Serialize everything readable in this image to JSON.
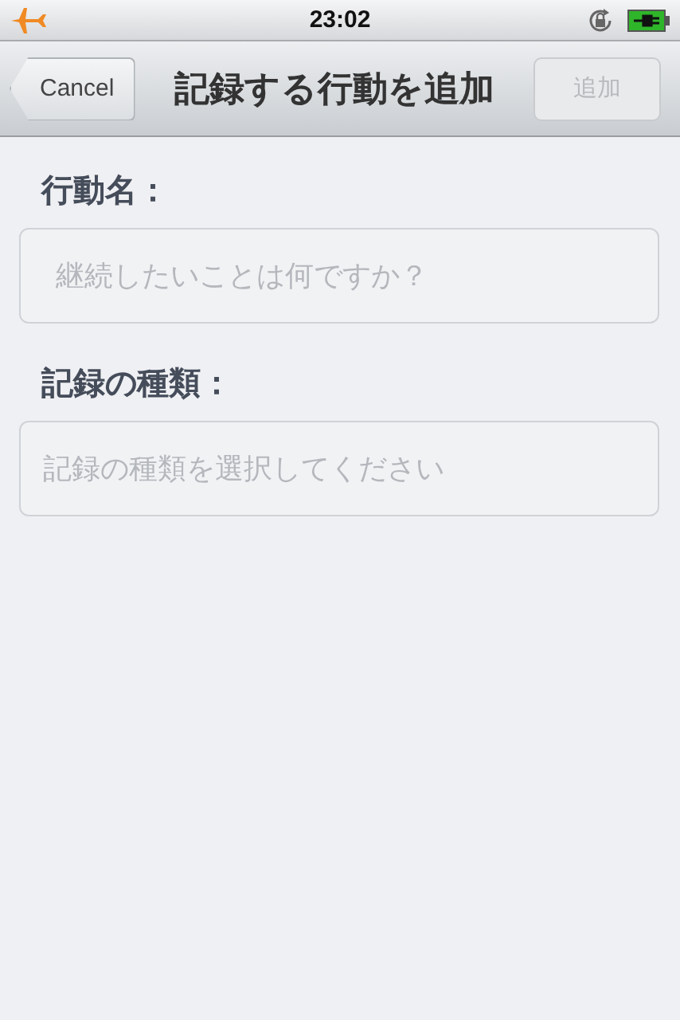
{
  "status_bar": {
    "time": "23:02"
  },
  "nav_bar": {
    "back_button": "Cancel",
    "title": "記録する行動を追加",
    "action_button": {
      "label": "追加",
      "disabled": true
    }
  },
  "fields": [
    {
      "label": "行動名：",
      "placeholder": "継続したいことは何ですか？"
    },
    {
      "label": "記録の種類：",
      "placeholder": "記録の種類を選択してください"
    }
  ]
}
